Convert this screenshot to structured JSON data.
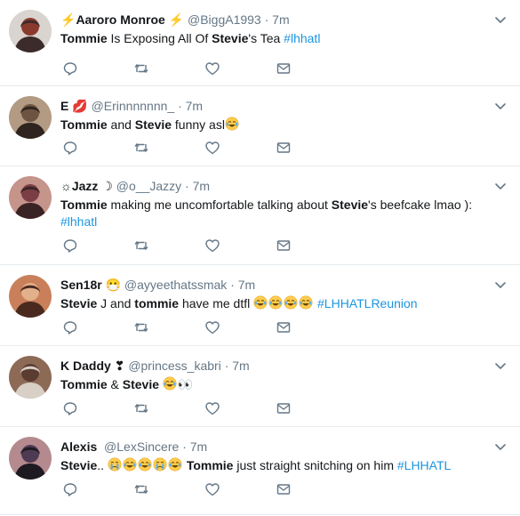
{
  "tweets": [
    {
      "name_prefix": "⚡",
      "name": "Aaroro Monroe",
      "name_suffix": "⚡",
      "handle": "@BiggA1993",
      "dot": "·",
      "time": "7m",
      "text": [
        {
          "t": "Tommie",
          "b": true
        },
        {
          "t": " Is Exposing All Of "
        },
        {
          "t": "Stevie",
          "b": true
        },
        {
          "t": "'s Tea "
        },
        {
          "t": "#lhhatl",
          "h": true
        }
      ],
      "avatar_colors": [
        "#3b2b2a",
        "#d9d4d0",
        "#8a3a2c"
      ]
    },
    {
      "name_prefix": "",
      "name": "E",
      "name_suffix": "💋",
      "handle": "@Erinnnnnnn_",
      "dot": "·",
      "time": "7m",
      "text": [
        {
          "t": "Tommie",
          "b": true
        },
        {
          "t": " and "
        },
        {
          "t": "Stevie",
          "b": true
        },
        {
          "t": " funny asl"
        },
        {
          "e": "😂"
        }
      ],
      "avatar_colors": [
        "#2f2420",
        "#b39a82",
        "#6d5442"
      ]
    },
    {
      "name_prefix": "☼",
      "name": "Jazz",
      "name_suffix": "☽",
      "handle": "@o__Jazzy",
      "dot": "·",
      "time": "7m",
      "text": [
        {
          "t": "Tommie",
          "b": true
        },
        {
          "t": " making me uncomfortable talking about "
        },
        {
          "t": "Stevie",
          "b": true
        },
        {
          "t": "'s beefcake lmao ):"
        },
        {
          "br": true
        },
        {
          "t": "#lhhatl",
          "h": true
        }
      ],
      "avatar_colors": [
        "#3a2325",
        "#c5948a",
        "#7a3e44"
      ]
    },
    {
      "name_prefix": "",
      "name": "Sen18r",
      "name_suffix": "😷",
      "handle": "@ayyeethatssmak",
      "dot": "·",
      "time": "7m",
      "text": [
        {
          "t": "Stevie",
          "b": true
        },
        {
          "t": " J  and "
        },
        {
          "t": "tommie",
          "b": true
        },
        {
          "t": " have me dtfl "
        },
        {
          "e": "😂😂😂😂"
        },
        {
          "t": " "
        },
        {
          "t": "#LHHATLReunion",
          "h": true
        }
      ],
      "avatar_colors": [
        "#4a2a1f",
        "#c9805a",
        "#e3b08c"
      ]
    },
    {
      "name_prefix": "",
      "name": "K Daddy",
      "name_suffix": "❣",
      "handle": "@princess_kabri",
      "dot": "·",
      "time": "7m",
      "text": [
        {
          "t": "Tommie",
          "b": true
        },
        {
          "t": " & "
        },
        {
          "t": "Stevie",
          "b": true
        },
        {
          "t": " "
        },
        {
          "e": "😂"
        },
        {
          "t": "👀"
        }
      ],
      "avatar_colors": [
        "#d8cfc6",
        "#8c6a56",
        "#5a3c30"
      ]
    },
    {
      "name_prefix": "",
      "name": "Alexis",
      "name_suffix": "",
      "handle": "@LexSincere",
      "dot": "·",
      "time": "7m",
      "text": [
        {
          "t": "Stevie",
          "b": true
        },
        {
          "t": ".. "
        },
        {
          "e": "😭😂😂😭😂"
        },
        {
          "t": " "
        },
        {
          "t": "Tommie",
          "b": true
        },
        {
          "t": " just straight snitching on him "
        },
        {
          "t": "#LHHATL",
          "h": true
        }
      ],
      "avatar_colors": [
        "#1e1a22",
        "#b48a8e",
        "#4e3a52"
      ]
    }
  ],
  "icons": {
    "reply": "reply-icon",
    "retweet": "retweet-icon",
    "like": "heart-icon",
    "dm": "mail-icon",
    "caret": "chevron-down-icon"
  },
  "colors": {
    "name": "#14171a",
    "muted": "#657786",
    "hashtag": "#1b95e0",
    "divider": "#e6ecf0"
  }
}
